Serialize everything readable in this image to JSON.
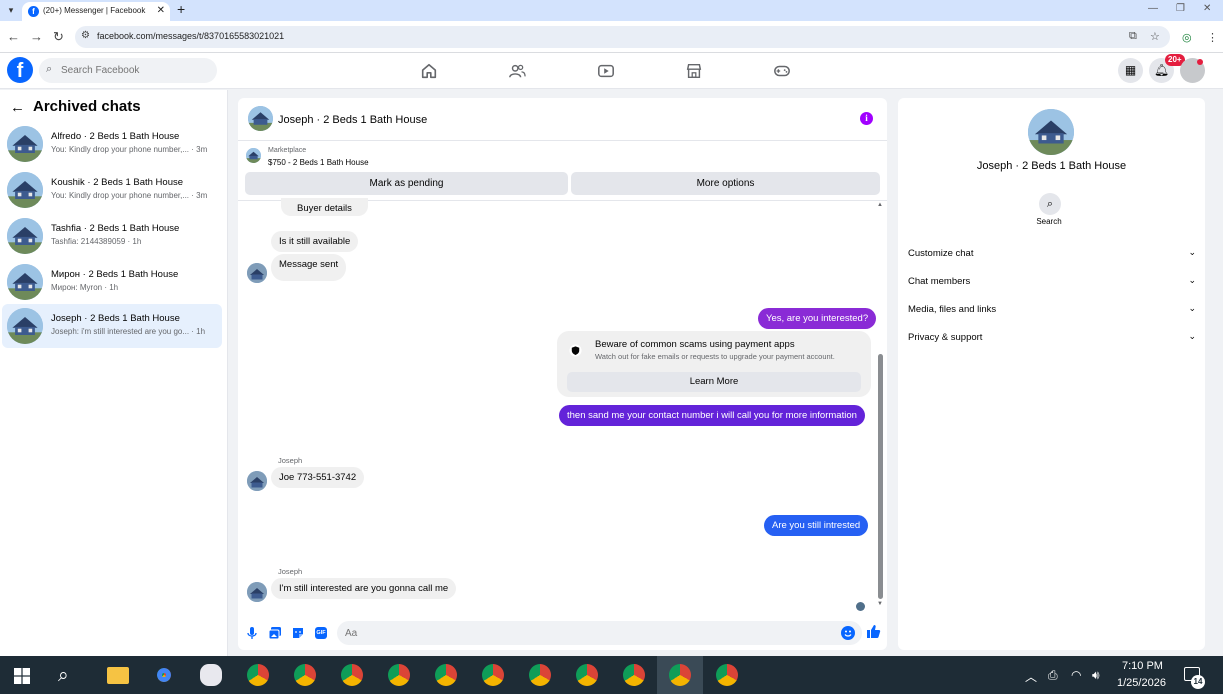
{
  "browser": {
    "tab_title": "(20+) Messenger | Facebook",
    "url": "facebook.com/messages/t/8370165583021021"
  },
  "fb_nav": {
    "logo": "f",
    "search_placeholder": "Search Facebook",
    "notification_badge": "20+",
    "nav_icons": [
      "home-icon",
      "friends-icon",
      "video-icon",
      "marketplace-icon",
      "gaming-icon"
    ]
  },
  "left": {
    "title": "Archived chats",
    "chats": [
      {
        "name": "Alfredo · 2 Beds 1 Bath House",
        "snippet": "You: Kindly drop your phone number,... · 3m"
      },
      {
        "name": "Koushik · 2 Beds 1 Bath House",
        "snippet": "You: Kindly drop your phone number,... · 3m"
      },
      {
        "name": "Tashfia · 2 Beds 1 Bath House",
        "snippet": "Tashfia: 2144389059 · 1h"
      },
      {
        "name": "Мирон · 2 Beds 1 Bath House",
        "snippet": "Мирон: Myron · 1h"
      },
      {
        "name": "Joseph · 2 Beds 1 Bath House",
        "snippet": "Joseph: i'm still interested are you go... · 1h"
      }
    ]
  },
  "conversation": {
    "title": "Joseph · 2 Beds 1 Bath House",
    "marketplace_label": "Marketplace",
    "listing": "$750 - 2 Beds 1 Bath House",
    "mark_pending": "Mark as pending",
    "more_options": "More options",
    "buyer_details": "Buyer details",
    "messages": {
      "m1": "Is it still available",
      "m2": "Message sent",
      "m3": "Yes, are you interested?",
      "m4": "then sand me your contact number i will call you for more information",
      "sender1": "Joseph",
      "m5": "Joe 773-551-3742",
      "m6": "Are you still intrested",
      "sender2": "Joseph",
      "m7": "I'm still interested are you gonna call me"
    },
    "scam_notice": {
      "title": "Beware of common scams using payment apps",
      "subtitle": "Watch out for fake emails or requests to upgrade your payment account.",
      "button": "Learn More"
    },
    "composer_placeholder": "Aa",
    "gif_label": "GIF"
  },
  "right_panel": {
    "name": "Joseph · 2 Beds 1 Bath House",
    "search_label": "Search",
    "sections": [
      "Customize chat",
      "Chat members",
      "Media, files and links",
      "Privacy & support"
    ]
  },
  "taskbar": {
    "time": "7:10 PM",
    "date": "1/25/2026",
    "notifications": "14"
  }
}
